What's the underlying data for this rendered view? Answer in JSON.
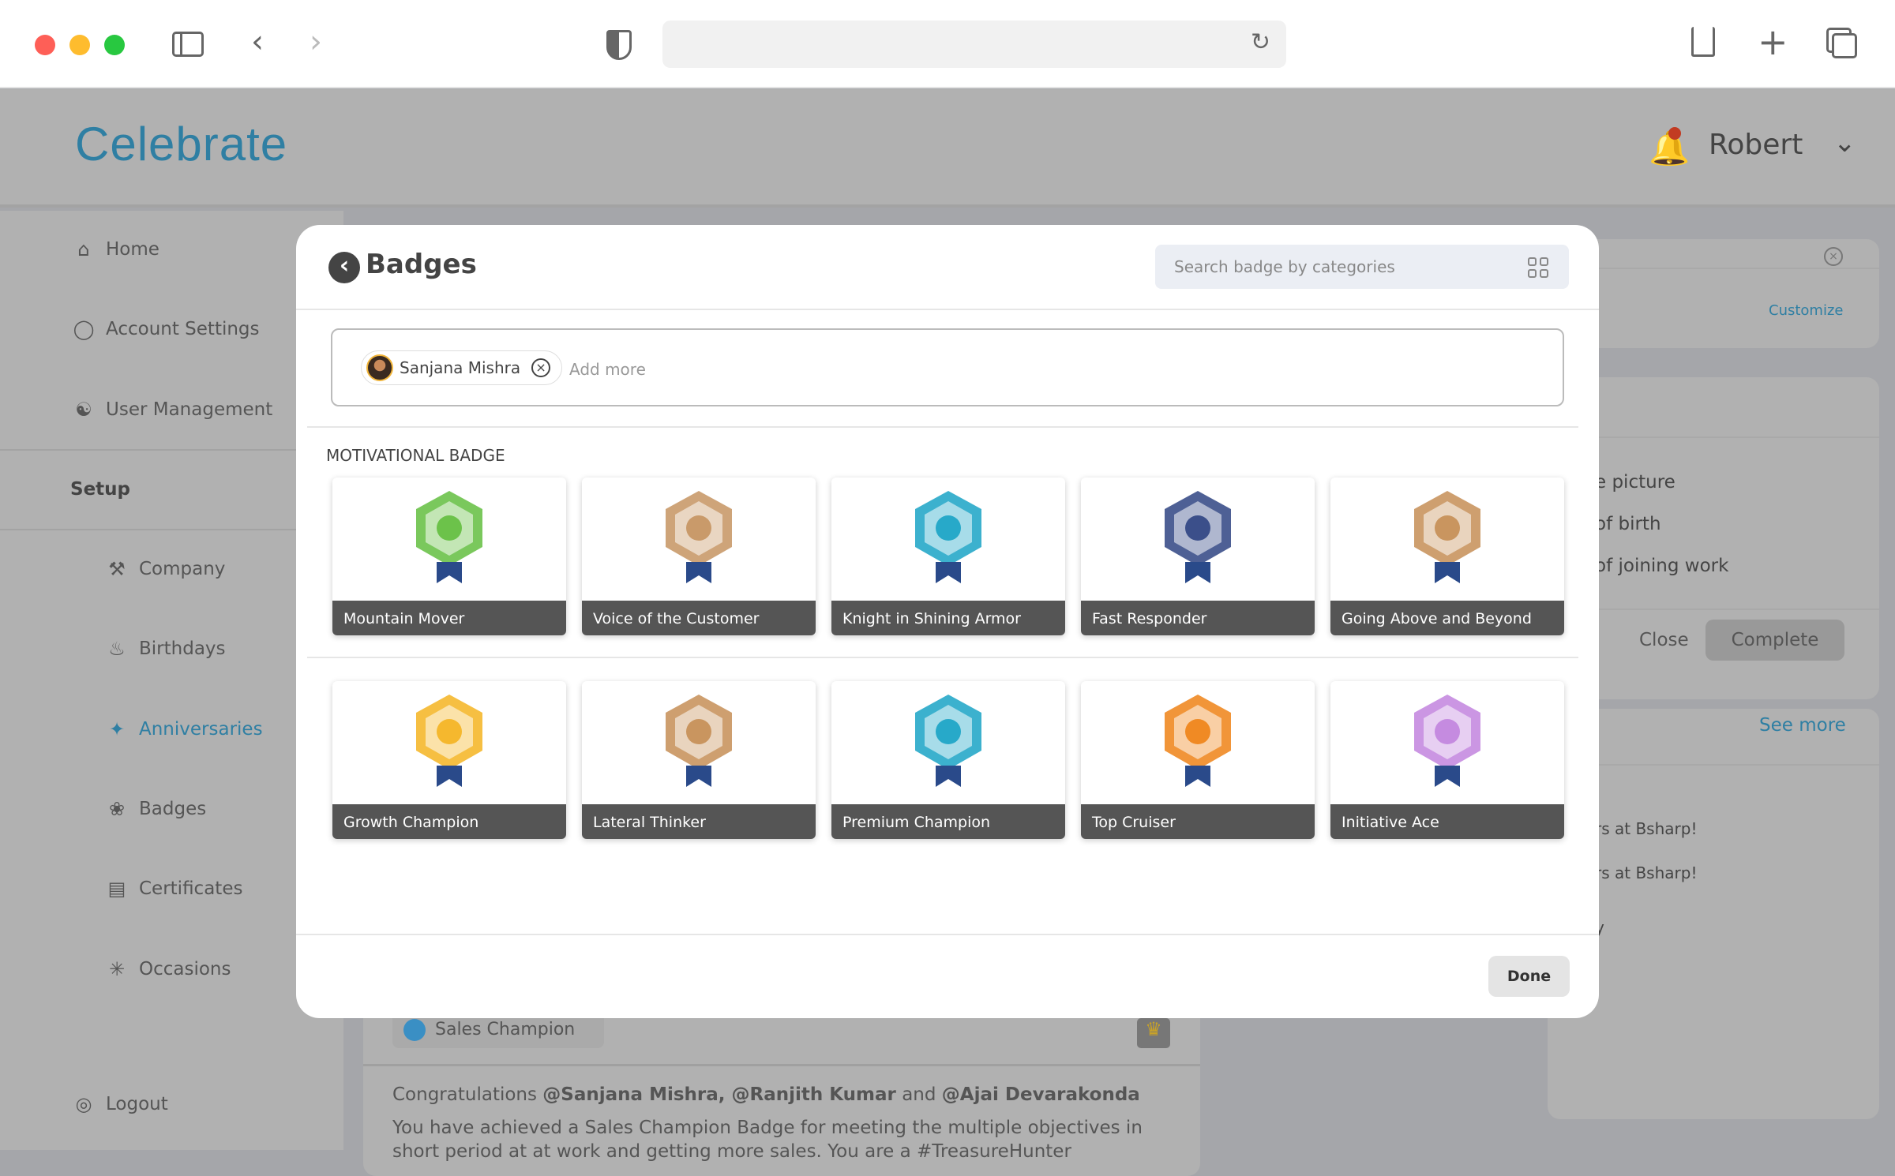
{
  "browser": {
    "icons": [
      "sidebar-icon",
      "back-icon",
      "forward-icon",
      "shield-icon",
      "reload-icon",
      "share-icon",
      "new-tab-icon",
      "tabs-icon"
    ]
  },
  "app": {
    "logo": "Celebrate",
    "user": "Robert"
  },
  "sidebar": {
    "items": [
      {
        "label": "Home",
        "icon": "home-icon"
      },
      {
        "label": "Account Settings",
        "icon": "account-icon"
      },
      {
        "label": "User Management",
        "icon": "users-icon"
      },
      {
        "label": "Setup",
        "heading": true
      },
      {
        "label": "Company",
        "icon": "company-icon"
      },
      {
        "label": "Birthdays",
        "icon": "cake-icon"
      },
      {
        "label": "Anniversaries",
        "icon": "anniversary-icon",
        "active": true
      },
      {
        "label": "Badges",
        "icon": "badge-icon"
      },
      {
        "label": "Certificates",
        "icon": "certificate-icon"
      },
      {
        "label": "Occasions",
        "icon": "party-icon"
      }
    ],
    "logout": "Logout"
  },
  "background": {
    "customize": "Customize",
    "profile_items": [
      "e picture",
      "of birth",
      "of joining work"
    ],
    "close": "Close",
    "complete": "Complete",
    "see_more": "See more",
    "list": [
      "rs at Bsharp!",
      "rs at Bsharp!",
      "y"
    ],
    "post": {
      "chip": "Sales Champion",
      "congrats_prefix": "Congratulations ",
      "mentions": "@Sanjana Mishra, @Ranjith Kumar",
      "and": " and ",
      "mention_last": "@Ajai Devarakonda",
      "body": "You have achieved a Sales Champion Badge for meeting the multiple objectives in",
      "body2": "short period at at work and getting more sales. You are a #TreasureHunter"
    }
  },
  "modal": {
    "title": "Badges",
    "search_placeholder": "Search badge by categories",
    "recipients": [
      {
        "name": "Sanjana Mishra"
      }
    ],
    "add_more": "Add more",
    "section": "MOTIVATIONAL BADGE",
    "badges": [
      {
        "name": "Mountain Mover",
        "color": "#6cc24a"
      },
      {
        "name": "Voice of the Customer",
        "color": "#c99a6a"
      },
      {
        "name": "Knight in Shining Armor",
        "color": "#27a9c9"
      },
      {
        "name": "Fast Responder",
        "color": "#3b4f8a"
      },
      {
        "name": "Going Above and Beyond",
        "color": "#c9955f"
      },
      {
        "name": "Growth Champion",
        "color": "#f5b82e"
      },
      {
        "name": "Lateral Thinker",
        "color": "#c9955f"
      },
      {
        "name": "Premium Champion",
        "color": "#27a9c9"
      },
      {
        "name": "Top Cruiser",
        "color": "#f08a24"
      },
      {
        "name": "Initiative Ace",
        "color": "#c58be0"
      }
    ],
    "done": "Done"
  },
  "colors": {
    "accent": "#2f7fa3",
    "overlay": "#a5a6aa",
    "label_bar": "#555555"
  }
}
